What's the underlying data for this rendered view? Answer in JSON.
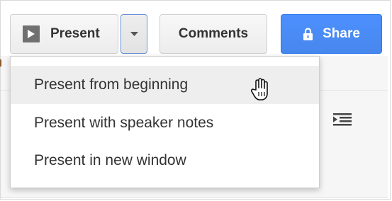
{
  "toolbar": {
    "present_label": "Present",
    "comments_label": "Comments",
    "share_label": "Share"
  },
  "present_menu": {
    "items": [
      {
        "label": "Present from beginning",
        "hovered": true
      },
      {
        "label": "Present with speaker notes",
        "hovered": false
      },
      {
        "label": "Present in new window",
        "hovered": false
      }
    ]
  },
  "icons": {
    "present": "play-icon",
    "dropdown": "chevron-down-icon",
    "share": "lock-icon",
    "cursor": "hand-pointer-icon",
    "background": "indent-icon"
  },
  "colors": {
    "share_bg": "#4d90fe",
    "dropdown_focus_border": "#6a8fd6",
    "hover_bg": "#eeeeee"
  }
}
